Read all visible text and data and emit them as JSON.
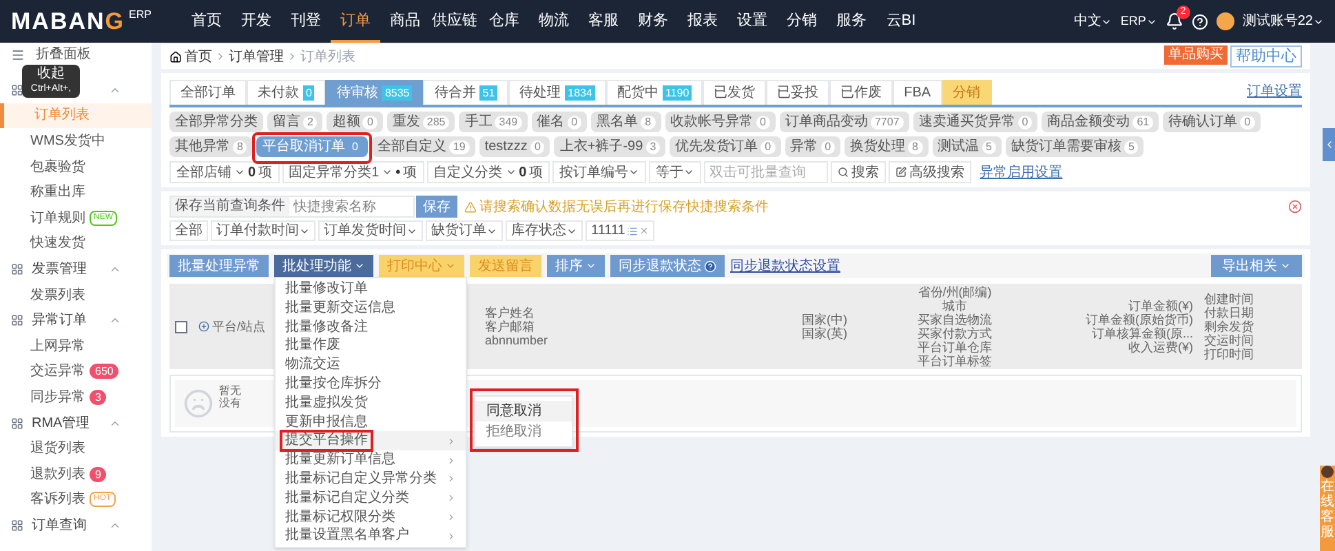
{
  "nav": {
    "logo": "MABANG",
    "logo_suffix": "ERP",
    "items": [
      {
        "label": "首页",
        "selected": false
      },
      {
        "label": "开发",
        "selected": false
      },
      {
        "label": "刊登",
        "selected": false
      },
      {
        "label": "订单",
        "selected": true
      },
      {
        "label": "商品",
        "selected": false
      },
      {
        "label": "供应链",
        "selected": false
      },
      {
        "label": "仓库",
        "selected": false
      },
      {
        "label": "物流",
        "selected": false
      },
      {
        "label": "客服",
        "selected": false
      },
      {
        "label": "财务",
        "selected": false
      },
      {
        "label": "报表",
        "selected": false
      },
      {
        "label": "设置",
        "selected": false
      },
      {
        "label": "分销",
        "selected": false
      },
      {
        "label": "服务",
        "selected": false
      },
      {
        "label": "云BI",
        "selected": false
      }
    ],
    "language": "中文",
    "system": "ERP",
    "notification_count": "2",
    "user": "测试账号22"
  },
  "sidebar": {
    "collapse_label": "折叠面板",
    "tooltip": {
      "title": "收起",
      "shortcut": "Ctrl+Alt+,"
    },
    "groups": [
      {
        "expanded": true,
        "items": [
          {
            "label": "订单列表",
            "selected": true
          },
          {
            "label": "WMS发货中",
            "selected": false
          },
          {
            "label": "包裹验货",
            "selected": false
          },
          {
            "label": "称重出库",
            "selected": false
          },
          {
            "label": "订单规则",
            "selected": false,
            "badge": {
              "kind": "tag",
              "text": "NEW",
              "color": "#52c41a"
            }
          },
          {
            "label": "快速发货",
            "selected": false
          }
        ]
      },
      {
        "label": "发票管理",
        "expanded": true,
        "items": [
          {
            "label": "发票列表",
            "selected": false
          }
        ]
      },
      {
        "label": "异常订单",
        "expanded": true,
        "items": [
          {
            "label": "上网异常",
            "selected": false
          },
          {
            "label": "交运异常",
            "selected": false,
            "badge": {
              "kind": "count",
              "text": "650",
              "color": "#f0506e"
            }
          },
          {
            "label": "同步异常",
            "selected": false,
            "badge": {
              "kind": "count",
              "text": "3",
              "color": "#f0506e"
            }
          }
        ]
      },
      {
        "label": "RMA管理",
        "expanded": true,
        "items": [
          {
            "label": "退货列表",
            "selected": false
          },
          {
            "label": "退款列表",
            "selected": false,
            "badge": {
              "kind": "count",
              "text": "9",
              "color": "#f0506e"
            }
          },
          {
            "label": "客诉列表",
            "selected": false,
            "badge": {
              "kind": "tag",
              "text": "HOT",
              "color": "#f5a04a"
            }
          }
        ]
      },
      {
        "label": "订单查询",
        "expanded": true
      }
    ]
  },
  "breadcrumb": [
    "首页",
    "订单管理",
    "订单列表"
  ],
  "header_buttons": [
    {
      "label": "单品购买",
      "kind": "solid"
    },
    {
      "label": "帮助中心",
      "kind": "outline"
    }
  ],
  "tabs": [
    {
      "label": "全部订单",
      "selected": false,
      "kind": "normal"
    },
    {
      "label": "未付款",
      "count": "0",
      "selected": false,
      "kind": "normal"
    },
    {
      "label": "待审核",
      "count": "8535",
      "selected": true,
      "kind": "normal"
    },
    {
      "label": "待合并",
      "count": "51",
      "selected": false,
      "kind": "normal"
    },
    {
      "label": "待处理",
      "count": "1834",
      "selected": false,
      "kind": "normal"
    },
    {
      "label": "配货中",
      "count": "1190",
      "selected": false,
      "kind": "normal"
    },
    {
      "label": "已发货",
      "selected": false,
      "kind": "normal"
    },
    {
      "label": "已妥投",
      "selected": false,
      "kind": "normal"
    },
    {
      "label": "已作废",
      "selected": false,
      "kind": "normal"
    },
    {
      "label": "FBA",
      "selected": false,
      "kind": "normal"
    },
    {
      "label": "分销",
      "selected": false,
      "kind": "promo"
    }
  ],
  "order_settings_link": "订单设置",
  "exception_chips": [
    {
      "label": "全部异常分类",
      "selected": false,
      "annotated": false
    },
    {
      "label": "留言",
      "count": "2",
      "selected": false,
      "annotated": false
    },
    {
      "label": "超额",
      "count": "0",
      "selected": false,
      "annotated": false
    },
    {
      "label": "重发",
      "count": "285",
      "selected": false,
      "annotated": false
    },
    {
      "label": "手工",
      "count": "349",
      "selected": false,
      "annotated": false
    },
    {
      "label": "催名",
      "count": "0",
      "selected": false,
      "annotated": false
    },
    {
      "label": "黑名单",
      "count": "8",
      "selected": false,
      "annotated": false
    },
    {
      "label": "收款帐号异常",
      "count": "0",
      "selected": false,
      "annotated": false
    },
    {
      "label": "订单商品变动",
      "count": "7707",
      "selected": false,
      "annotated": false
    },
    {
      "label": "速卖通买货异常",
      "count": "0",
      "selected": false,
      "annotated": false
    },
    {
      "label": "商品金额变动",
      "count": "61",
      "selected": false,
      "annotated": false
    },
    {
      "label": "待确认订单",
      "count": "0",
      "selected": false,
      "annotated": false
    },
    {
      "label": "其他异常",
      "count": "8",
      "selected": false,
      "annotated": false
    },
    {
      "label": "平台取消订单",
      "count": "0",
      "selected": true,
      "annotated": true
    },
    {
      "label": "全部自定义",
      "count": "19",
      "selected": false,
      "annotated": false
    },
    {
      "label": "testzzz",
      "count": "0",
      "selected": false,
      "annotated": false
    },
    {
      "label": "上衣+裤子-99",
      "count": "3",
      "selected": false,
      "annotated": false
    },
    {
      "label": "优先发货订单",
      "count": "0",
      "selected": false,
      "annotated": false
    },
    {
      "label": "异常",
      "count": "0",
      "selected": false,
      "annotated": false
    },
    {
      "label": "换货处理",
      "count": "8",
      "selected": false,
      "annotated": false
    },
    {
      "label": "测试温",
      "count": "5",
      "selected": false,
      "annotated": false
    },
    {
      "label": "缺货订单需要审核",
      "count": "5",
      "selected": false,
      "annotated": false
    }
  ],
  "filters": [
    {
      "label": "全部店铺",
      "count": "0",
      "unit": "项"
    },
    {
      "label": "固定异常分类1",
      "count": "•",
      "unit": "项"
    },
    {
      "label": "自定义分类",
      "count": "0",
      "unit": "项"
    }
  ],
  "search": {
    "field": "按订单编号",
    "operator": "等于",
    "placeholder": "双击可批量查询",
    "search_button": "搜索",
    "advanced_button": "高级搜索",
    "settings_link": "异常启用设置"
  },
  "quick_search": {
    "label": "保存当前查询条件",
    "placeholder": "快捷搜索名称",
    "save_button": "保存",
    "warning": "请搜索确认数据无误后再进行保存快捷搜索条件"
  },
  "quick_filters": [
    "全部",
    "订单付款时间",
    "订单发货时间",
    "缺货订单",
    "库存状态"
  ],
  "saved_filter": "11111",
  "actions": [
    {
      "label": "批量处理异常",
      "kind": "blue",
      "dropdown": false
    },
    {
      "label": "批处理功能",
      "kind": "dark",
      "dropdown": true
    },
    {
      "label": "打印中心",
      "kind": "yellow",
      "dropdown": true
    },
    {
      "label": "发送留言",
      "kind": "yellow",
      "dropdown": false
    },
    {
      "label": "排序",
      "kind": "blue",
      "dropdown": true
    },
    {
      "label": "同步退款状态",
      "kind": "help",
      "dropdown": false
    }
  ],
  "sync_settings_link": "同步退款状态设置",
  "export_button": "导出相关",
  "table": {
    "select_all_checked": false,
    "columns": [
      {
        "lines": [
          "平台/站点"
        ],
        "kind": "expand"
      },
      {
        "lines": [
          "客户姓名",
          "客户邮箱",
          "abnnumber"
        ],
        "kind": "left"
      },
      {
        "lines": [
          "国家(中)",
          "国家(英)"
        ],
        "kind": "right"
      },
      {
        "lines": [
          "省份/州(邮编)",
          "城市",
          "买家自选物流",
          "买家付款方式",
          "平台订单仓库",
          "平台订单标签"
        ],
        "kind": "center"
      },
      {
        "lines": [
          "订单金额(¥)",
          "订单金额(原始货币)",
          "订单核算金额(原...",
          "收入运费(¥)"
        ],
        "kind": "right"
      },
      {
        "lines": [
          "创建时间",
          "付款日期",
          "剩余发货",
          "交运时间",
          "打印时间"
        ],
        "kind": "left"
      }
    ],
    "empty_lines": [
      "暂无",
      "没有"
    ]
  },
  "menu": {
    "items": [
      {
        "label": "批量修改订单",
        "submenu": false,
        "selected": false
      },
      {
        "label": "批量更新交运信息",
        "submenu": false,
        "selected": false
      },
      {
        "label": "批量修改备注",
        "submenu": false,
        "selected": false
      },
      {
        "label": "批量作废",
        "submenu": false,
        "selected": false
      },
      {
        "label": "物流交运",
        "submenu": false,
        "selected": false
      },
      {
        "label": "批量按仓库拆分",
        "submenu": false,
        "selected": false
      },
      {
        "label": "批量虚拟发货",
        "submenu": false,
        "selected": false
      },
      {
        "label": "更新申报信息",
        "submenu": false,
        "selected": false
      },
      {
        "label": "提交平台操作",
        "submenu": true,
        "selected": true,
        "annotated": true
      },
      {
        "label": "批量更新订单信息",
        "submenu": true,
        "selected": false
      },
      {
        "label": "批量标记自定义异常分类",
        "submenu": true,
        "selected": false
      },
      {
        "label": "批量标记自定义分类",
        "submenu": true,
        "selected": false
      },
      {
        "label": "批量标记权限分类",
        "submenu": true,
        "selected": false
      },
      {
        "label": "批量设置黑名单客户",
        "submenu": true,
        "selected": false
      }
    ],
    "submenu": {
      "annotated": true,
      "items": [
        {
          "label": "同意取消",
          "selected": true
        },
        {
          "label": "拒绝取消",
          "selected": false
        }
      ]
    }
  },
  "support_widget": "在线客服"
}
